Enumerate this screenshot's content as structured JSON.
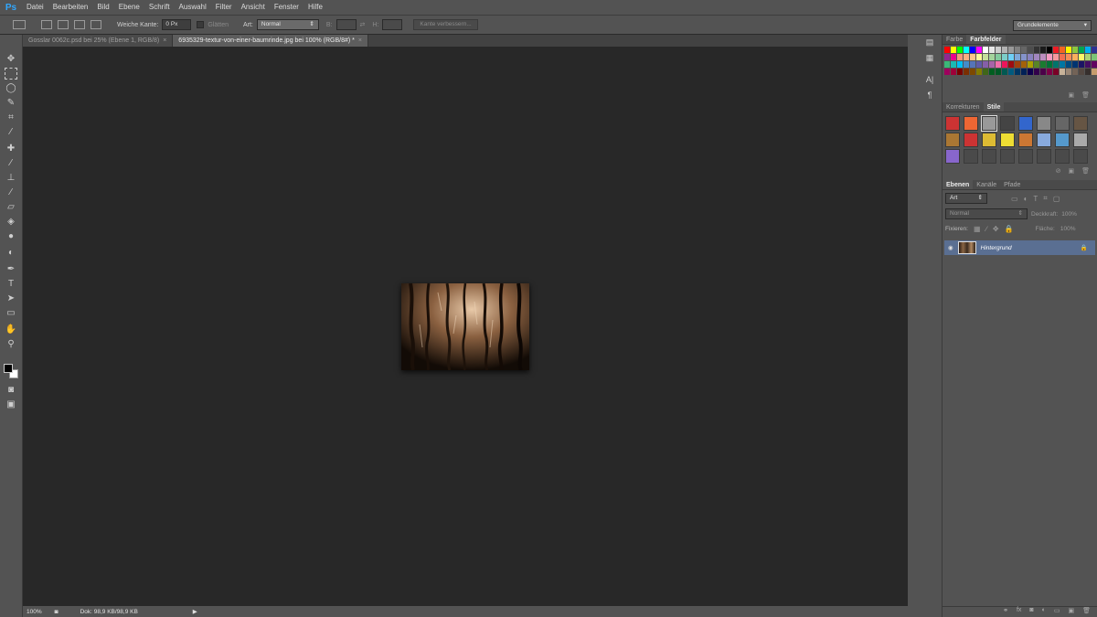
{
  "app": {
    "logo": "Ps"
  },
  "menu": [
    "Datei",
    "Bearbeiten",
    "Bild",
    "Ebene",
    "Schrift",
    "Auswahl",
    "Filter",
    "Ansicht",
    "Fenster",
    "Hilfe"
  ],
  "options": {
    "feather_label": "Weiche Kante:",
    "feather_value": "0 Px",
    "antialias_label": "Glätten",
    "style_label": "Art:",
    "style_value": "Normal",
    "width_label": "B:",
    "height_label": "H:",
    "refine_label": "Kante verbessern...",
    "workspace": "Grundelemente"
  },
  "tabs": [
    {
      "label": "Gosslar 0062c.psd bei 25% (Ebene 1, RGB/8)",
      "active": false
    },
    {
      "label": "6935329-textur-von-einer-baumrinde.jpg bei 100% (RGB/8#) *",
      "active": true
    }
  ],
  "status": {
    "zoom": "100%",
    "doc": "Dok: 98,9 KB/98,9 KB"
  },
  "panels": {
    "color_tabs": [
      "Farbe",
      "Farbfelder"
    ],
    "adjust_tabs": [
      "Korrekturen",
      "Stile"
    ],
    "layers_tabs": [
      "Ebenen",
      "Kanäle",
      "Pfade"
    ],
    "filter_kind": "Art",
    "blend_mode": "Normal",
    "opacity_label": "Deckkraft:",
    "opacity_value": "100%",
    "lock_label": "Fixieren:",
    "fill_label": "Fläche:",
    "fill_value": "100%",
    "layer_name": "Hintergrund"
  },
  "colors": {
    "swatches": [
      "#ff0000",
      "#ffff00",
      "#00ff00",
      "#00ffff",
      "#0000ff",
      "#ff00ff",
      "#ffffff",
      "#e6e6e6",
      "#cccccc",
      "#b3b3b3",
      "#999999",
      "#808080",
      "#666666",
      "#4d4d4d",
      "#333333",
      "#1a1a1a",
      "#000000",
      "#ed1c24",
      "#f26522",
      "#fff200",
      "#8dc63f",
      "#00a651",
      "#00aeef",
      "#2e3192",
      "#92278f",
      "#ec008c",
      "#f69679",
      "#f9ad81",
      "#fdc68a",
      "#fff79a",
      "#c4df9b",
      "#a3d39c",
      "#82ca9d",
      "#7bcdc8",
      "#6ecff6",
      "#7ea7d8",
      "#8493ca",
      "#8882be",
      "#a186be",
      "#bc8dbf",
      "#f49ac1",
      "#f5989d",
      "#f26c4f",
      "#f68e56",
      "#fbaf5d",
      "#fff568",
      "#acd373",
      "#7cc576",
      "#3bb878",
      "#1abbb4",
      "#00bff3",
      "#438cca",
      "#5574b9",
      "#605ca8",
      "#855fa8",
      "#a763a8",
      "#f06eaa",
      "#ed145b",
      "#9e0b0f",
      "#a0410d",
      "#a36209",
      "#aba000",
      "#598527",
      "#1a7b30",
      "#007236",
      "#00746b",
      "#0076a3",
      "#004a80",
      "#003471",
      "#1b1464",
      "#440e62",
      "#630460",
      "#9e005d",
      "#9e0039",
      "#790000",
      "#7b2e00",
      "#7d4900",
      "#827b00",
      "#406618",
      "#005e20",
      "#005826",
      "#005952",
      "#005b7f",
      "#003663",
      "#002157",
      "#0d004c",
      "#32004b",
      "#4b0049",
      "#7b0046",
      "#7a0026",
      "#c7b299",
      "#998675",
      "#736357",
      "#534741",
      "#362f2d",
      "#c69c6d"
    ],
    "styles": [
      "#c33",
      "#e63",
      "#999",
      "#444",
      "#36c",
      "#888",
      "#666",
      "#654",
      "#a73",
      "#c33",
      "#db3",
      "#ed3",
      "#c73",
      "#8ad",
      "#59c",
      "#aaa",
      "#86c",
      "#555",
      "#555",
      "#555",
      "#555",
      "#555",
      "#555",
      "#555"
    ]
  }
}
